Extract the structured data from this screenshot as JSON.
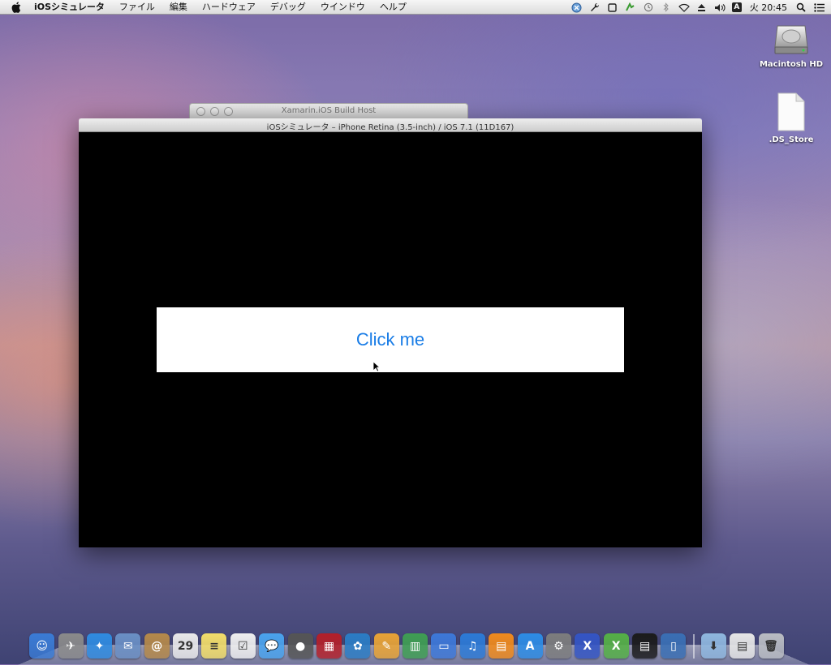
{
  "menubar": {
    "app_name": "iOSシミュレータ",
    "items": [
      "ファイル",
      "編集",
      "ハードウェア",
      "デバッグ",
      "ウインドウ",
      "ヘルプ"
    ],
    "input_indicator": "A",
    "clock": "火 20:45"
  },
  "desktop": {
    "icons": [
      {
        "label": "Macintosh HD",
        "icon": "hard-drive-icon"
      },
      {
        "label": ".DS_Store",
        "icon": "document-icon"
      }
    ]
  },
  "windows": {
    "build_host": {
      "title": "Xamarin.iOS Build Host"
    },
    "simulator": {
      "title": "iOSシミュレータ – iPhone Retina (3.5-inch) / iOS 7.1 (11D167)",
      "button_label": "Click me"
    }
  },
  "dock": {
    "apps": [
      {
        "name": "finder-icon",
        "color": "#3a7bd5",
        "glyph": "☺"
      },
      {
        "name": "launchpad-icon",
        "color": "#8a8a8a",
        "glyph": "✈"
      },
      {
        "name": "safari-icon",
        "color": "#2f8be0",
        "glyph": "✦"
      },
      {
        "name": "mail-icon",
        "color": "#6a8fc4",
        "glyph": "✉"
      },
      {
        "name": "contacts-icon",
        "color": "#b5894a",
        "glyph": "@"
      },
      {
        "name": "calendar-icon",
        "color": "#e9e9e9",
        "glyph": "29"
      },
      {
        "name": "notes-icon",
        "color": "#f2dd6a",
        "glyph": "≡"
      },
      {
        "name": "reminders-icon",
        "color": "#efefef",
        "glyph": "☑"
      },
      {
        "name": "messages-icon",
        "color": "#4aa3ee",
        "glyph": "💬"
      },
      {
        "name": "facetime-icon",
        "color": "#555555",
        "glyph": "●"
      },
      {
        "name": "photo-booth-icon",
        "color": "#b3202a",
        "glyph": "▦"
      },
      {
        "name": "iphoto-icon",
        "color": "#2b7cc4",
        "glyph": "✿"
      },
      {
        "name": "pages-icon",
        "color": "#e8a336",
        "glyph": "✎"
      },
      {
        "name": "numbers-icon",
        "color": "#3f9e53",
        "glyph": "▥"
      },
      {
        "name": "keynote-icon",
        "color": "#3d78d8",
        "glyph": "▭"
      },
      {
        "name": "itunes-icon",
        "color": "#2c7ad6",
        "glyph": "♫"
      },
      {
        "name": "ibooks-icon",
        "color": "#f08a1c",
        "glyph": "▤"
      },
      {
        "name": "app-store-icon",
        "color": "#2d8ce5",
        "glyph": "A"
      },
      {
        "name": "system-preferences-icon",
        "color": "#7d7d7d",
        "glyph": "⚙"
      },
      {
        "name": "xamarin-studio-icon",
        "color": "#3455c4",
        "glyph": "X"
      },
      {
        "name": "xamarin-icon",
        "color": "#55b046",
        "glyph": "X"
      },
      {
        "name": "console-icon",
        "color": "#1b1b1b",
        "glyph": "▤"
      },
      {
        "name": "ios-simulator-icon",
        "color": "#3a6fb4",
        "glyph": "▯"
      }
    ],
    "stacks": [
      {
        "name": "downloads-folder-icon",
        "color": "#8fb7de",
        "glyph": "⬇"
      },
      {
        "name": "documents-stack-icon",
        "color": "#e6e6e6",
        "glyph": "▤"
      },
      {
        "name": "trash-icon",
        "color": "#b9bcc2",
        "glyph": "🗑"
      }
    ]
  }
}
